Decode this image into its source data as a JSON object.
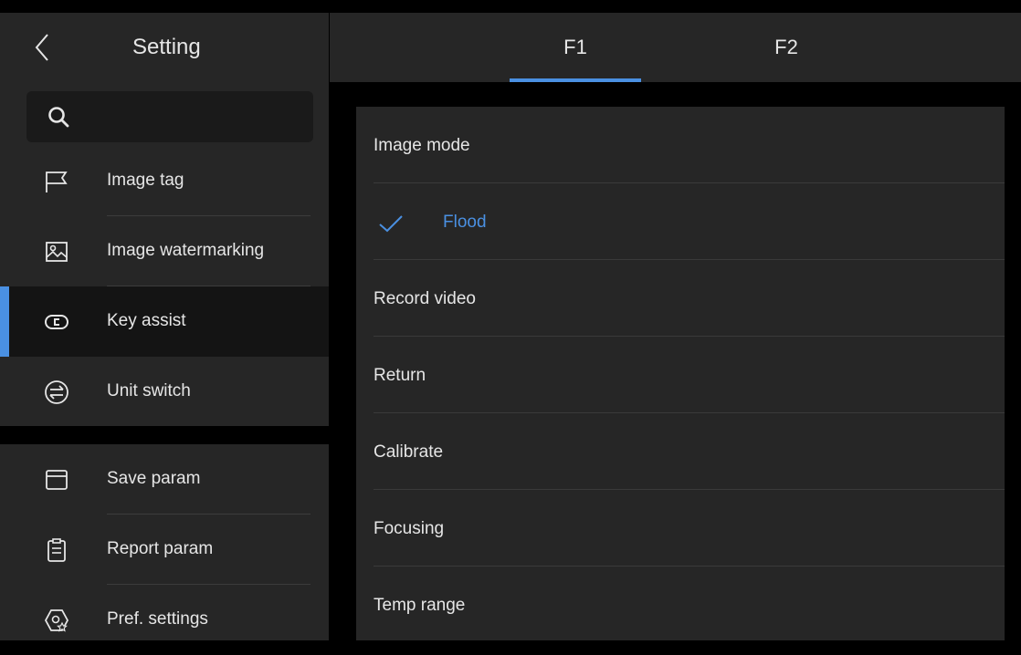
{
  "header": {
    "title": "Setting"
  },
  "search": {
    "placeholder": ""
  },
  "sidebar": {
    "items": [
      {
        "label": "Image tag",
        "icon": "flag-icon"
      },
      {
        "label": "Image watermarking",
        "icon": "image-icon"
      },
      {
        "label": "Key assist",
        "icon": "key-icon",
        "active": true
      },
      {
        "label": "Unit switch",
        "icon": "switch-icon"
      },
      {
        "label": "Save param",
        "icon": "save-icon"
      },
      {
        "label": "Report param",
        "icon": "clipboard-icon"
      },
      {
        "label": "Pref. settings",
        "icon": "pref-settings-icon"
      }
    ]
  },
  "tabs": [
    {
      "label": "F1",
      "active": true
    },
    {
      "label": "F2",
      "active": false
    }
  ],
  "list": {
    "rows": [
      {
        "label": "Image mode"
      },
      {
        "label": "Flood",
        "selected": true
      },
      {
        "label": "Record video"
      },
      {
        "label": "Return"
      },
      {
        "label": "Calibrate"
      },
      {
        "label": "Focusing"
      },
      {
        "label": "Temp range"
      }
    ]
  },
  "colors": {
    "accent": "#4a90e2",
    "panel": "#262626",
    "background": "#000000"
  }
}
